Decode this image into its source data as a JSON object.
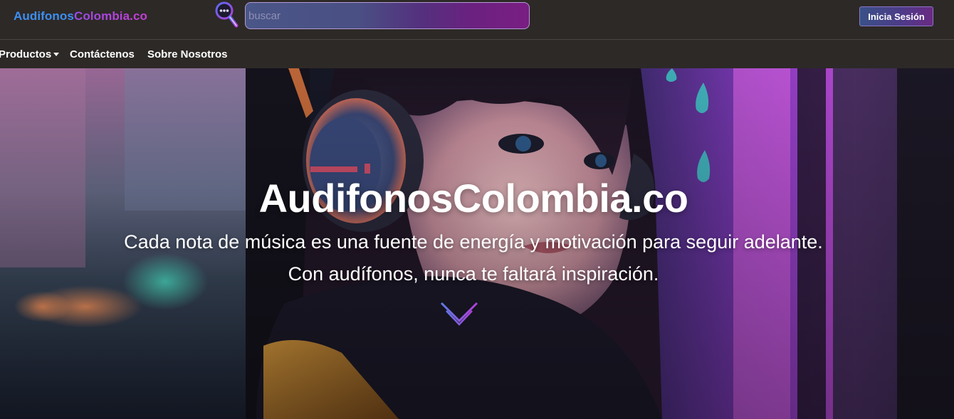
{
  "header": {
    "brand_part1": "Audifonos",
    "brand_part2": "Colombia.co",
    "search": {
      "placeholder": "buscar",
      "value": ""
    },
    "login_label": "Inicia Sesión"
  },
  "nav": {
    "items": [
      {
        "label": "Productos",
        "has_dropdown": true
      },
      {
        "label": "Contáctenos"
      },
      {
        "label": "Sobre Nosotros"
      }
    ]
  },
  "hero": {
    "title": "AudifonosColombia.co",
    "subtitle": "Cada nota de música es una fuente de energía y motivación para seguir adelante. Con audífonos, nunca te faltará inspiración.",
    "scroll_icon": "chevron-down-icon"
  },
  "colors": {
    "header_bg": "#2d2927",
    "brand_blue": "#3d8ff2",
    "brand_purple": "#b044de",
    "accent_violet": "#8a3fd6"
  }
}
